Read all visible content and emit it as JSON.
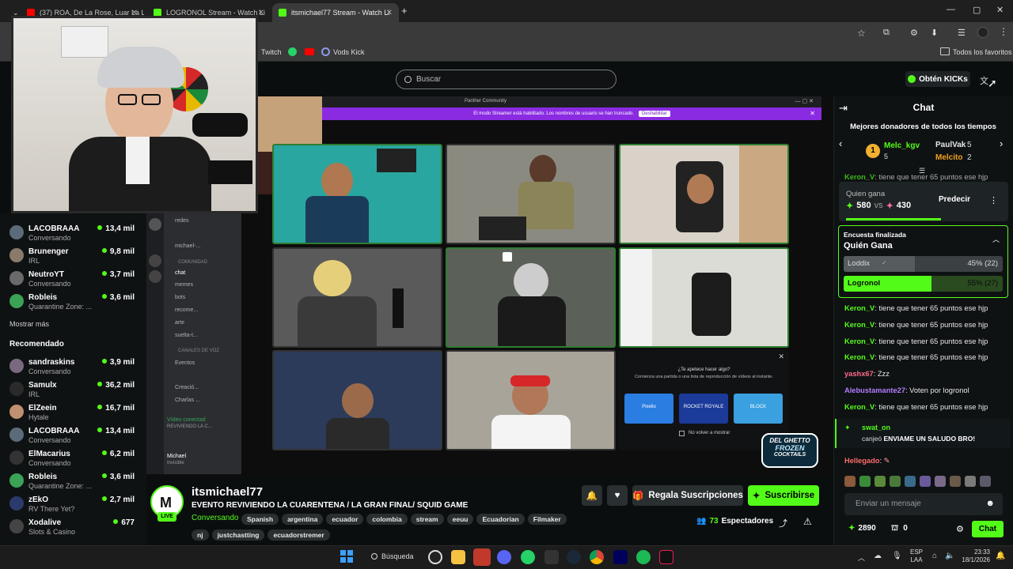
{
  "browser": {
    "tabs": [
      {
        "title": "(37) ROA, De La Rose, Luar La L",
        "favicon_color": "#ff0000",
        "active": false
      },
      {
        "title": "LOGRONOL Stream - Watch Li",
        "favicon_color": "#53fc18",
        "active": false
      },
      {
        "title": "itsmichael77 Stream - Watch Li",
        "favicon_color": "#53fc18",
        "active": true
      }
    ],
    "new_tab": "+",
    "bookmarks": [
      "Twitch",
      "Vods Kick"
    ],
    "favorites_folder": "Todos los favoritos"
  },
  "header": {
    "search_placeholder": "Buscar",
    "get_kicks": "Obtén KICKs",
    "brand_color": "#53fc18"
  },
  "sidebar": {
    "following": [
      {
        "name": "LACOBRAAA",
        "sub": "Conversando",
        "viewers": "13,4 mil",
        "color": "#5b6b7a"
      },
      {
        "name": "Brunenger",
        "sub": "IRL",
        "viewers": "9,8 mil",
        "color": "#8a7a6a"
      },
      {
        "name": "NeutroYT",
        "sub": "Conversando",
        "viewers": "3,7 mil",
        "color": "#6a6a6a"
      },
      {
        "name": "Robleis",
        "sub": "Quarantine Zone: ...",
        "viewers": "3,6 mil",
        "color": "#3aa356"
      }
    ],
    "show_more": "Mostrar más",
    "recommended_title": "Recomendado",
    "recommended": [
      {
        "name": "sandraskins",
        "sub": "Conversando",
        "viewers": "3,9 mil",
        "color": "#7a6a80"
      },
      {
        "name": "Samulx",
        "sub": "IRL",
        "viewers": "36,2 mil",
        "color": "#2a2a2a"
      },
      {
        "name": "ElZeein",
        "sub": "Hytale",
        "viewers": "16,7 mil",
        "color": "#c09070"
      },
      {
        "name": "LACOBRAAA",
        "sub": "Conversando",
        "viewers": "13,4 mil",
        "color": "#5b6b7a"
      },
      {
        "name": "ElMacarius",
        "sub": "Conversando",
        "viewers": "6,2 mil",
        "color": "#333333"
      },
      {
        "name": "Robleis",
        "sub": "Quarantine Zone: ...",
        "viewers": "3,6 mil",
        "color": "#3aa356"
      },
      {
        "name": "zEkO",
        "sub": "RV There Yet?",
        "viewers": "2,7 mil",
        "color": "#2a3a6a"
      },
      {
        "name": "Xodalive",
        "sub": "Slots & Casino",
        "viewers": "677",
        "color": "#444444"
      }
    ]
  },
  "stream_overlay": {
    "discord_title": "Panther Community",
    "streamer_notice": "El modo Streamer está habilitado. Los nombres de usuario se han truncado.",
    "disable": "Deshabilitar",
    "channels_community": "COMUNIDAD",
    "channels": [
      "redes",
      "michael-...",
      "chat",
      "memes",
      "bots",
      "recome...",
      "arte",
      "suelta-t..."
    ],
    "voice_header": "CANALES DE VOZ",
    "voice_channels": [
      "Eventos",
      "Creació...",
      "Charlas ..."
    ],
    "voice_status": "Vídeo conectad",
    "voice_sub": "REVIVIENDO LA C...",
    "user": "Michael",
    "user_status": "Invisible",
    "activity_title": "¿Te apetece hacer algo?",
    "activity_sub": "Comienza una partida o una lista de reproducción de vídeos al instante.",
    "activity_games": [
      "Pixelio",
      "ROCKET ROYALE",
      "BLOCK"
    ],
    "dont_show": "No volver a mostrar",
    "logo_text1": "DEL GHETTO",
    "logo_text2": "FROZEN",
    "logo_text3": "COCKTAILS"
  },
  "channel": {
    "name": "itsmichael77",
    "live": "LIVE",
    "title": "EVENTO REVIVIENDO LA CUARENTENA / LA GRAN FINAL/ SQUID GAME",
    "category": "Conversando",
    "tags": [
      "Spanish",
      "argentina",
      "ecuador",
      "colombia",
      "stream",
      "eeuu",
      "Ecuadorian",
      "Filmaker",
      "nj",
      "justchastting",
      "ecuadorstremer"
    ],
    "gift_subs": "Regala Suscripciones",
    "subscribe": "Suscribirse",
    "viewers": "73",
    "viewers_label": "Espectadores"
  },
  "chat": {
    "title": "Chat",
    "donors_title": "Mejores donadores de todos los tiempos",
    "donors": [
      {
        "rank": "1",
        "name": "Melc_kgv",
        "count": "5",
        "color": "#53fc18"
      },
      {
        "name": "PaulVak",
        "count": "5",
        "color": "#e8e8e8"
      },
      {
        "name": "Melcito",
        "count": "2",
        "color": "#f0a020"
      }
    ],
    "prediction": {
      "question": "Quien gana",
      "left": "580",
      "vs": "vs",
      "right": "430",
      "button": "Predecir"
    },
    "poll": {
      "status": "Encuesta finalizada",
      "title": "Quién Gana",
      "options": [
        {
          "label": "Loddix",
          "pct": "45% (22)",
          "value": 45,
          "winner": false
        },
        {
          "label": "Logronol",
          "pct": "55% (27)",
          "value": 55,
          "winner": true
        }
      ]
    },
    "partial_msg": {
      "user": "Keron_V",
      "text": "tiene que tener 65 puntos ese hjp"
    },
    "messages": [
      {
        "user": "Keron_V",
        "text": "tiene que tener 65 puntos ese hjp",
        "color": "#53fc18"
      },
      {
        "user": "Keron_V",
        "text": "tiene que tener 65 puntos ese hjp",
        "color": "#53fc18"
      },
      {
        "user": "Keron_V",
        "text": "tiene que tener 65 puntos ese hjp",
        "color": "#53fc18"
      },
      {
        "user": "Keron_V",
        "text": "tiene que tener 65 puntos ese hjp",
        "color": "#53fc18"
      },
      {
        "user": "yashx67",
        "text": "Zzz",
        "color": "#ff6b8a"
      },
      {
        "user": "Alebustamante27",
        "text": "Voten por logronol",
        "color": "#b47cff"
      },
      {
        "user": "Keron_V",
        "text": "tiene que tener 65 puntos ese hjp",
        "color": "#53fc18"
      }
    ],
    "redeem": {
      "user": "swat_on",
      "verb": "canjeó",
      "text": "ENVIAME UN SALUDO BRO!"
    },
    "last_user": "Hellegado",
    "input_placeholder": "Enviar un mensaje",
    "points": "2890",
    "drops": "0",
    "send": "Chat"
  },
  "taskbar": {
    "search": "Búsqueda",
    "lang1": "ESP",
    "lang2": "LAA",
    "time": "23:33",
    "date": "18/1/2026"
  }
}
